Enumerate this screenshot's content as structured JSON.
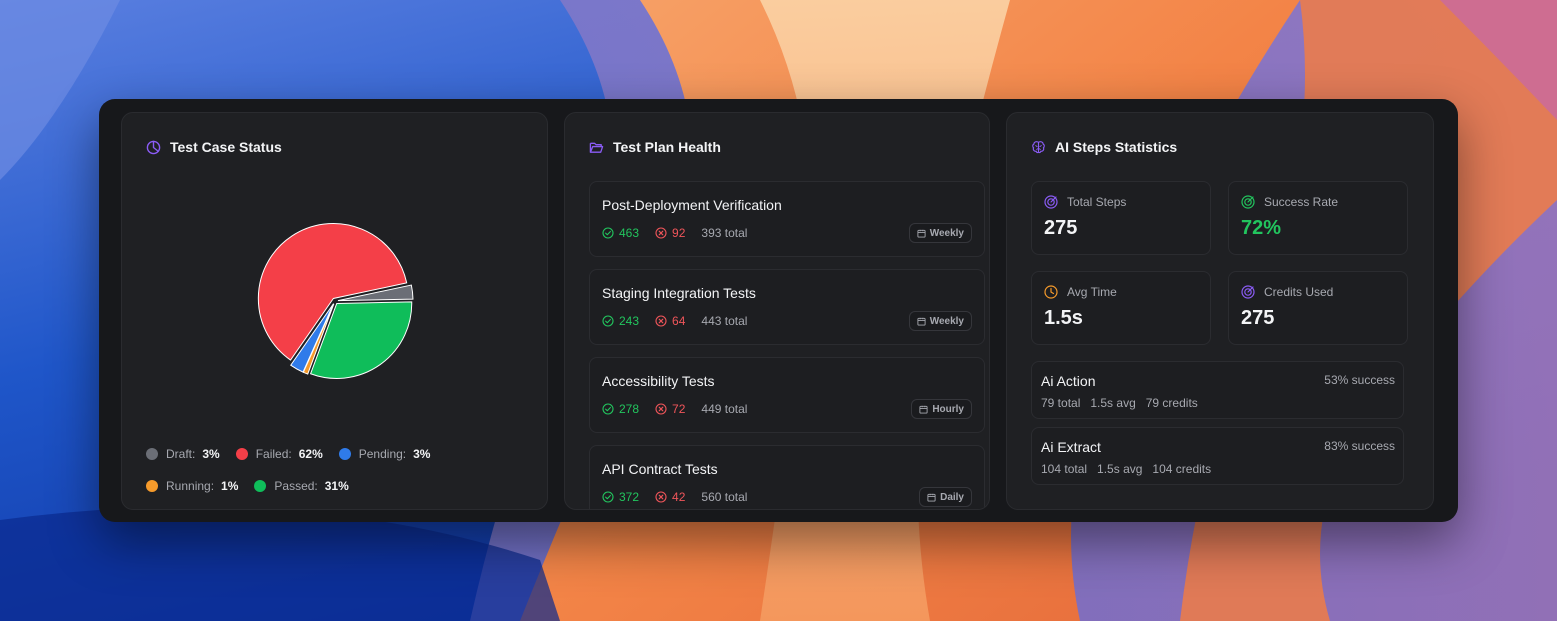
{
  "test_case_status": {
    "title": "Test Case Status",
    "legend": [
      {
        "label": "Draft:",
        "value": "3%",
        "color": "#6b6e76"
      },
      {
        "label": "Failed:",
        "value": "62%",
        "color": "#f43f48"
      },
      {
        "label": "Pending:",
        "value": "3%",
        "color": "#2f7bea"
      },
      {
        "label": "Running:",
        "value": "1%",
        "color": "#f59a2b"
      },
      {
        "label": "Passed:",
        "value": "31%",
        "color": "#0fbd5a"
      }
    ]
  },
  "chart_data": {
    "type": "pie",
    "slices": [
      {
        "name": "Draft",
        "value": 3,
        "color": "#6b6e76"
      },
      {
        "name": "Passed",
        "value": 31,
        "color": "#0fbd5a"
      },
      {
        "name": "Running",
        "value": 1,
        "color": "#f59a2b"
      },
      {
        "name": "Pending",
        "value": 3,
        "color": "#2f7bea"
      },
      {
        "name": "Failed",
        "value": 62,
        "color": "#f43f48"
      }
    ],
    "exploded": true
  },
  "test_plan_health": {
    "title": "Test Plan Health",
    "plans": [
      {
        "name": "Post-Deployment Verification",
        "passed": "463",
        "failed": "92",
        "total": "393 total",
        "schedule": "Weekly"
      },
      {
        "name": "Staging Integration Tests",
        "passed": "243",
        "failed": "64",
        "total": "443 total",
        "schedule": "Weekly"
      },
      {
        "name": "Accessibility Tests",
        "passed": "278",
        "failed": "72",
        "total": "449 total",
        "schedule": "Hourly"
      },
      {
        "name": "API Contract Tests",
        "passed": "372",
        "failed": "42",
        "total": "560 total",
        "schedule": "Daily"
      }
    ]
  },
  "ai_steps": {
    "title": "AI Steps Statistics",
    "metrics": [
      {
        "label": "Total Steps",
        "value": "275",
        "icon": "target-icon",
        "color": "#8b5cf6"
      },
      {
        "label": "Success Rate",
        "value": "72%",
        "icon": "target-icon",
        "color": "#22c55e"
      },
      {
        "label": "Avg Time",
        "value": "1.5s",
        "icon": "clock-icon",
        "color": "#f59a2b"
      },
      {
        "label": "Credits Used",
        "value": "275",
        "icon": "target-icon",
        "color": "#8b5cf6"
      }
    ],
    "actions": [
      {
        "name": "Ai Action",
        "success": "53% success",
        "total": "79 total",
        "avg": "1.5s avg",
        "credits": "79 credits"
      },
      {
        "name": "Ai Extract",
        "success": "83% success",
        "total": "104 total",
        "avg": "1.5s avg",
        "credits": "104 credits"
      }
    ]
  },
  "colors": {
    "panel_bg": "#17181b",
    "card_bg": "#1f2023",
    "accent_purple": "#8b5cf6",
    "pass_green": "#22c55e",
    "fail_red": "#f0555a"
  }
}
